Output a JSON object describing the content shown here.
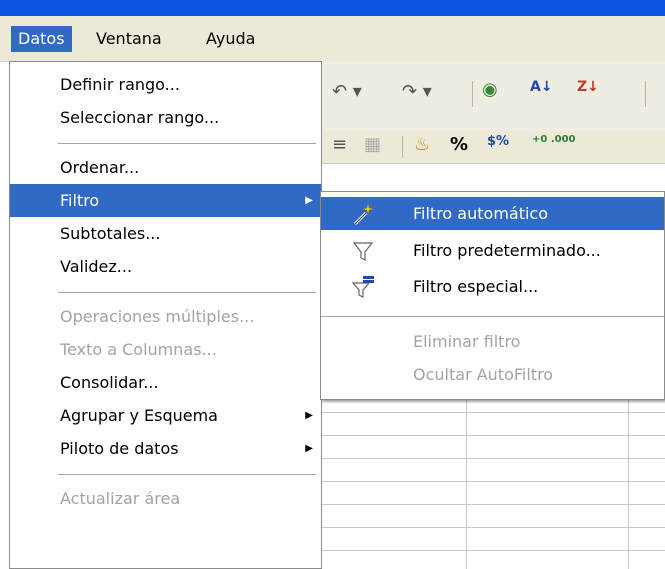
{
  "menubar": {
    "items": [
      {
        "label": "Datos"
      },
      {
        "label": "Ventana"
      },
      {
        "label": "Ayuda"
      }
    ]
  },
  "toolbar": {
    "row1": [
      "undo-icon",
      "redo-icon",
      "navigator-icon",
      "sort-ascending-icon",
      "sort-descending-icon"
    ],
    "row2": [
      "align-justify-icon",
      "merge-cells-icon",
      "currency-icon",
      "percent-icon",
      "standard-format-icon",
      "add-decimal-icon"
    ],
    "percent_label": "%",
    "currency_label": "$%",
    "add_decimal_label": "+0 .000",
    "sort_asc_label": "A↓",
    "sort_desc_label": "Z↓"
  },
  "datos_menu": {
    "items": [
      {
        "label": "Definir rango..."
      },
      {
        "label": "Seleccionar rango..."
      },
      {
        "label": "Ordenar..."
      },
      {
        "label": "Filtro"
      },
      {
        "label": "Subtotales..."
      },
      {
        "label": "Validez..."
      },
      {
        "label": "Operaciones múltiples..."
      },
      {
        "label": "Texto a Columnas..."
      },
      {
        "label": "Consolidar..."
      },
      {
        "label": "Agrupar y Esquema"
      },
      {
        "label": "Piloto de datos"
      },
      {
        "label": "Actualizar área"
      }
    ]
  },
  "filtro_submenu": {
    "items": [
      {
        "label": "Filtro automático",
        "icon": "magic-wand-icon"
      },
      {
        "label": "Filtro predeterminado...",
        "icon": "funnel-icon"
      },
      {
        "label": "Filtro especial...",
        "icon": "special-filter-icon"
      },
      {
        "label": "Eliminar filtro"
      },
      {
        "label": "Ocultar AutoFiltro"
      }
    ]
  },
  "colors": {
    "highlight": "#316ac5",
    "menubar_bg": "#ece9d8",
    "disabled_text": "#a3a3a3"
  }
}
